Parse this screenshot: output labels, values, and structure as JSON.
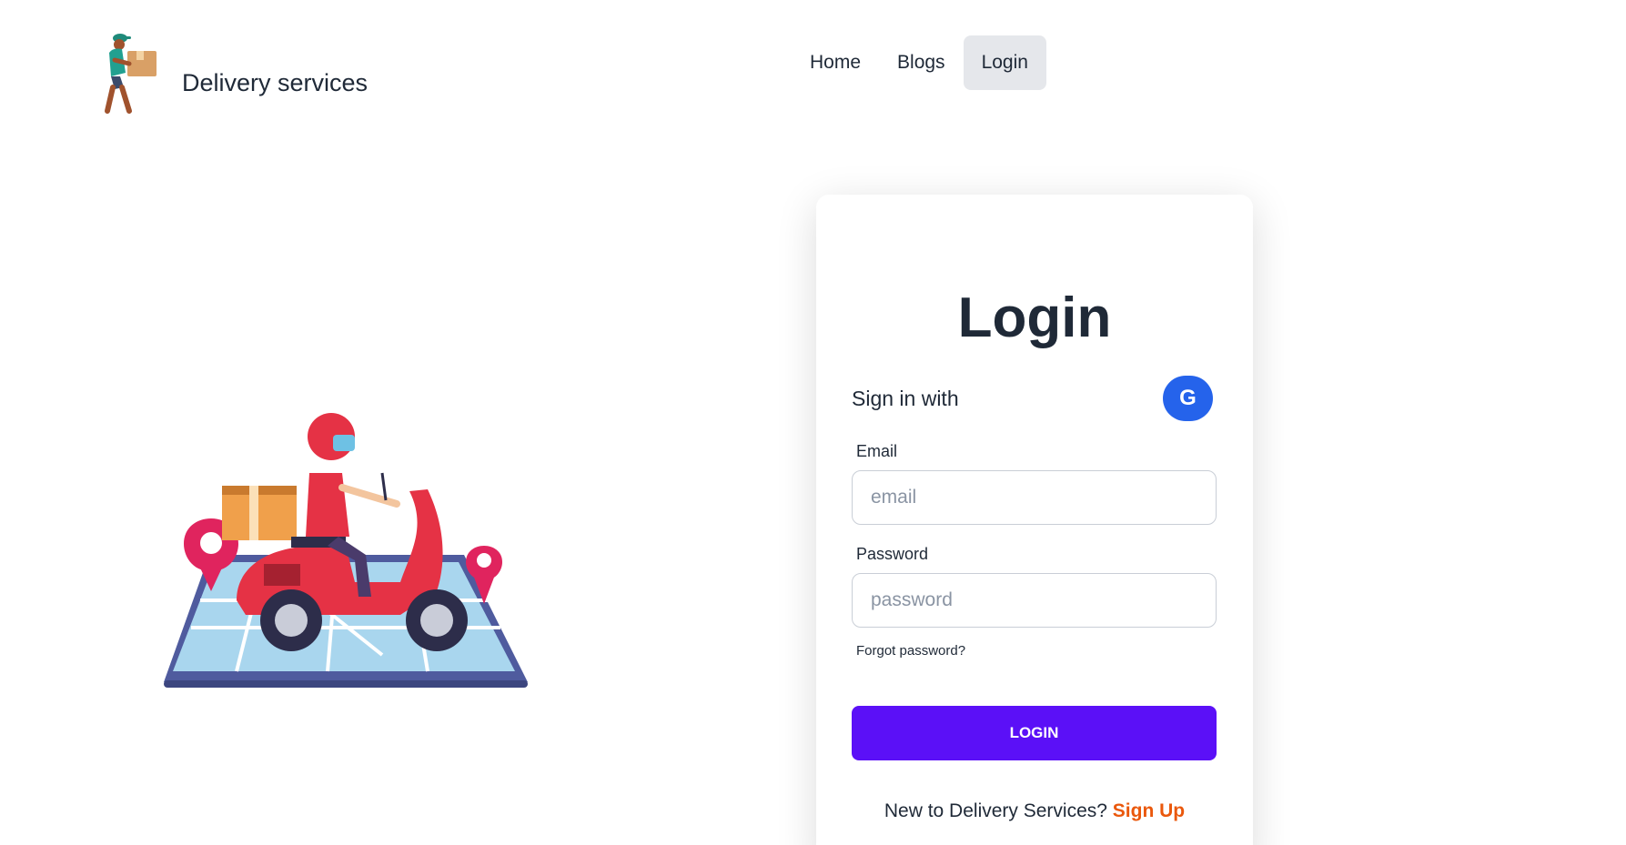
{
  "header": {
    "brand_name": "Delivery services",
    "nav": [
      {
        "label": "Home",
        "active": false
      },
      {
        "label": "Blogs",
        "active": false
      },
      {
        "label": "Login",
        "active": true
      }
    ]
  },
  "login_card": {
    "title": "Login",
    "sign_in_with": "Sign in with",
    "google_icon_letter": "G",
    "email": {
      "label": "Email",
      "placeholder": "email",
      "value": ""
    },
    "password": {
      "label": "Password",
      "placeholder": "password",
      "value": ""
    },
    "forgot_password": "Forgot password?",
    "submit_label": "LOGIN",
    "signup_prompt": "New to Delivery Services?",
    "signup_link": "Sign Up"
  },
  "colors": {
    "primary_button": "#5b10f7",
    "google_button": "#2563eb",
    "signup_link": "#ea580c",
    "nav_active_bg": "#e5e7eb"
  },
  "icons": {
    "brand_logo": "delivery-man-icon",
    "google": "google-icon",
    "hero": "delivery-scooter-illustration"
  }
}
